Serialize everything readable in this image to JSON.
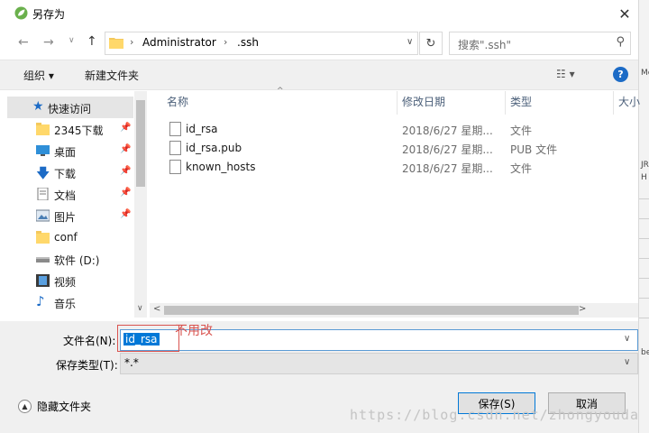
{
  "window": {
    "title": "另存为"
  },
  "nav": {
    "path": [
      "Administrator",
      ".ssh"
    ],
    "search_placeholder": "搜索\".ssh\""
  },
  "toolbar": {
    "organize": "组织 ▾",
    "new_folder": "新建文件夹",
    "help": "?"
  },
  "sidebar": {
    "items": [
      {
        "label": "快速访问",
        "icon": "star-icon",
        "pinned": false,
        "selected": true
      },
      {
        "label": "2345下载",
        "icon": "folder-icon",
        "pinned": true
      },
      {
        "label": "桌面",
        "icon": "desktop-icon",
        "pinned": true
      },
      {
        "label": "下载",
        "icon": "download-icon",
        "pinned": true
      },
      {
        "label": "文档",
        "icon": "document-icon",
        "pinned": true
      },
      {
        "label": "图片",
        "icon": "picture-icon",
        "pinned": true
      },
      {
        "label": "conf",
        "icon": "folder-icon",
        "pinned": false
      },
      {
        "label": "软件 (D:)",
        "icon": "drive-icon",
        "pinned": false
      },
      {
        "label": "视频",
        "icon": "video-icon",
        "pinned": false
      },
      {
        "label": "音乐",
        "icon": "music-icon",
        "pinned": false
      }
    ]
  },
  "columns": [
    "名称",
    "修改日期",
    "类型",
    "大小"
  ],
  "files": [
    {
      "name": "id_rsa",
      "date": "2018/6/27 星期...",
      "type": "文件"
    },
    {
      "name": "id_rsa.pub",
      "date": "2018/6/27 星期...",
      "type": "PUB 文件"
    },
    {
      "name": "known_hosts",
      "date": "2018/6/27 星期...",
      "type": "文件"
    }
  ],
  "form": {
    "filename_label": "文件名(N):",
    "filename_value": "id_rsa",
    "filetype_label": "保存类型(T):",
    "filetype_value": "*.*"
  },
  "footer": {
    "hide_folders": "隐藏文件夹",
    "save": "保存(S)",
    "cancel": "取消"
  },
  "annotation": "不用改",
  "watermark": "https://blog.csdn.net/zhongyouda",
  "background_strip": [
    "Me",
    "JR",
    "H",
    "be"
  ],
  "colors": {
    "accent": "#1c6bc6",
    "selection": "#cce8ff",
    "annotation": "#d9534f"
  }
}
